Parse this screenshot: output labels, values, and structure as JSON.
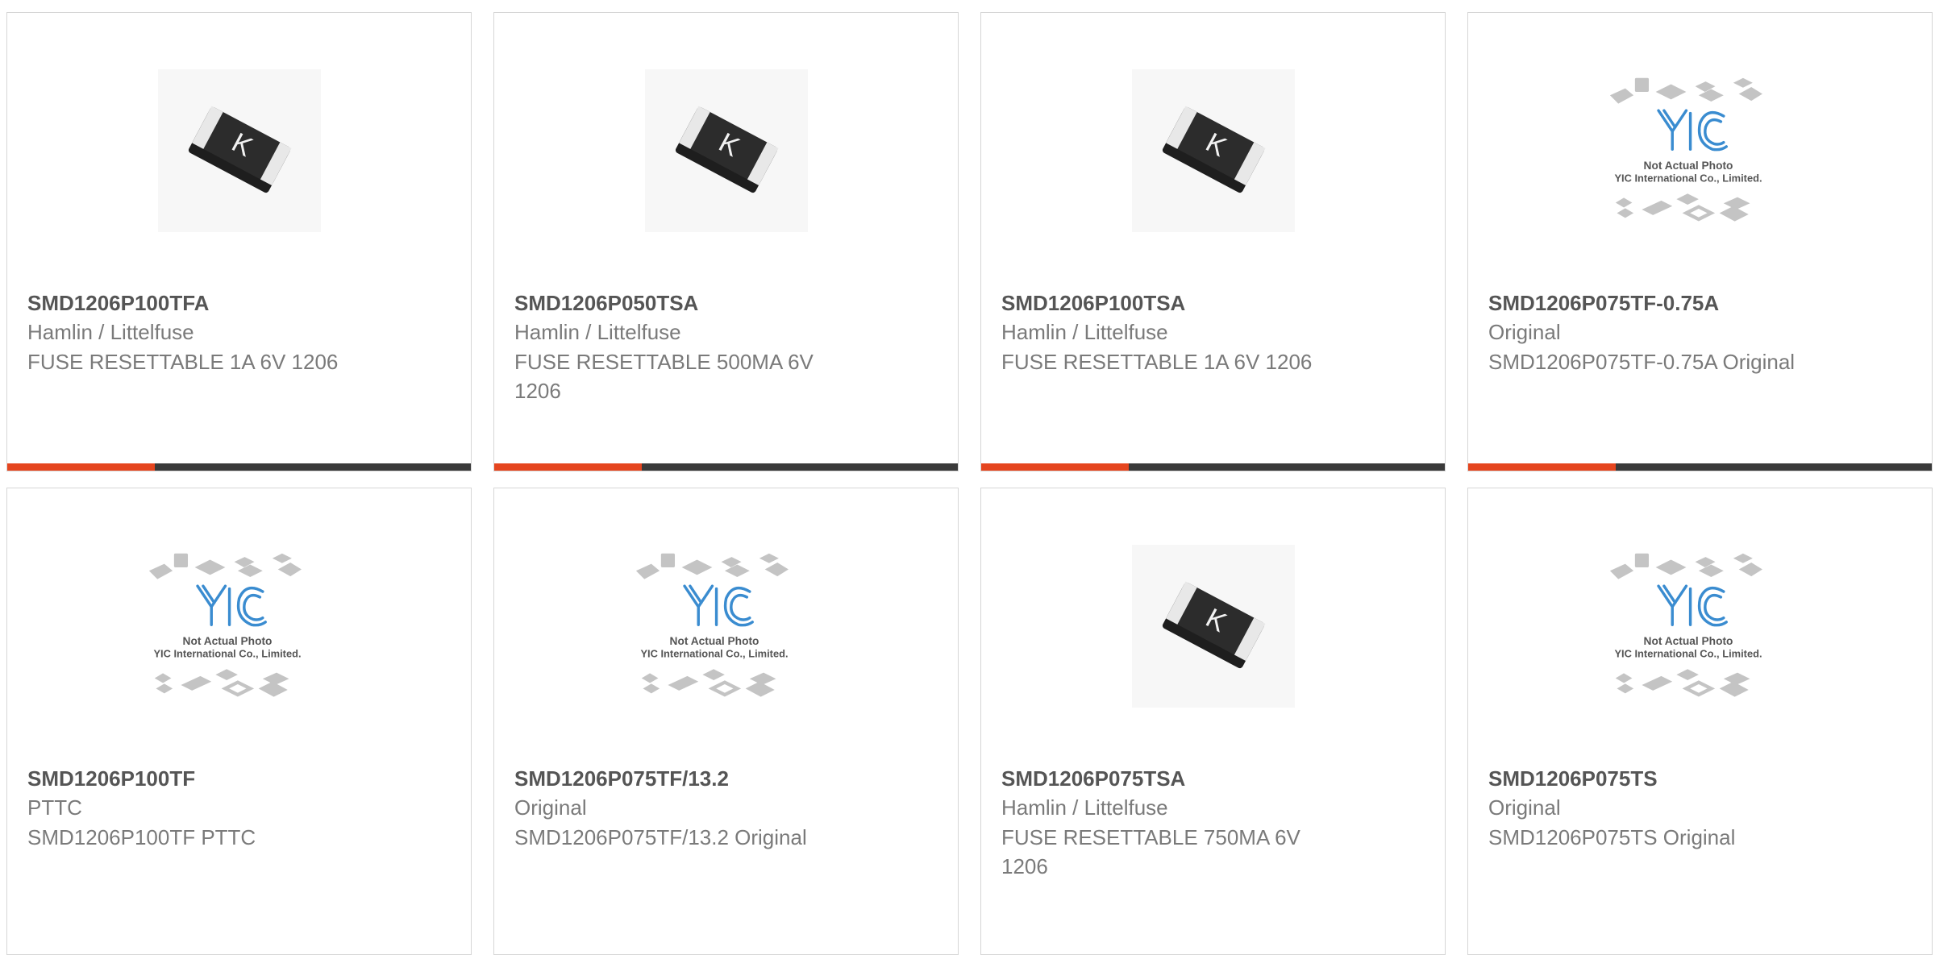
{
  "theme": {
    "accent": "#e5451f",
    "bar_dark": "#3a3a3a",
    "text_title": "#555555",
    "text_body": "#7a7a7a"
  },
  "products": [
    {
      "part_number": "SMD1206P100TFA",
      "manufacturer": "Hamlin / Littelfuse",
      "description": "FUSE RESETTABLE 1A 6V 1206",
      "image": "fuse-chip-icon"
    },
    {
      "part_number": "SMD1206P050TSA",
      "manufacturer": "Hamlin / Littelfuse",
      "description": "FUSE RESETTABLE 500MA 6V 1206",
      "image": "fuse-chip-icon"
    },
    {
      "part_number": "SMD1206P100TSA",
      "manufacturer": "Hamlin / Littelfuse",
      "description": "FUSE RESETTABLE 1A 6V 1206",
      "image": "fuse-chip-icon"
    },
    {
      "part_number": "SMD1206P075TF-0.75A",
      "manufacturer": "Original",
      "description": "SMD1206P075TF-0.75A Original",
      "image": "placeholder-logo"
    },
    {
      "part_number": "SMD1206P100TF",
      "manufacturer": "PTTC",
      "description": "SMD1206P100TF PTTC",
      "image": "placeholder-logo"
    },
    {
      "part_number": "SMD1206P075TF/13.2",
      "manufacturer": "Original",
      "description": "SMD1206P075TF/13.2 Original",
      "image": "placeholder-logo"
    },
    {
      "part_number": "SMD1206P075TSA",
      "manufacturer": "Hamlin / Littelfuse",
      "description": "FUSE RESETTABLE 750MA 6V 1206",
      "image": "fuse-chip-icon"
    },
    {
      "part_number": "SMD1206P075TS",
      "manufacturer": "Original",
      "description": "SMD1206P075TS Original",
      "image": "placeholder-logo"
    }
  ],
  "placeholder": {
    "line1": "Not Actual Photo",
    "line2": "YIC International Co., Limited.",
    "logo": "YIC"
  },
  "fuse_marking": "K"
}
